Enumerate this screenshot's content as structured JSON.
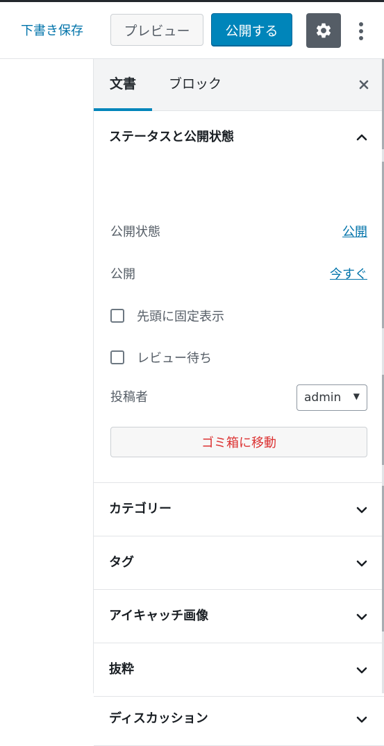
{
  "header": {
    "save_draft": "下書き保存",
    "preview": "プレビュー",
    "publish": "公開する",
    "settings_icon": "gear-icon",
    "more_icon": "more-vertical-icon"
  },
  "sidebar": {
    "tabs": [
      {
        "label": "文書",
        "active": true
      },
      {
        "label": "ブロック",
        "active": false
      }
    ],
    "close_icon": "close-icon",
    "status_panel": {
      "title": "ステータスと公開状態",
      "expanded": true,
      "visibility_label": "公開状態",
      "visibility_value": "公開",
      "publish_label": "公開",
      "publish_value": "今すぐ",
      "sticky_label": "先頭に固定表示",
      "sticky_checked": false,
      "pending_label": "レビュー待ち",
      "pending_checked": false,
      "author_label": "投稿者",
      "author_value": "admin",
      "trash_button": "ゴミ箱に移動"
    },
    "panels": [
      {
        "title": "カテゴリー",
        "expanded": false
      },
      {
        "title": "タグ",
        "expanded": false
      },
      {
        "title": "アイキャッチ画像",
        "expanded": false
      },
      {
        "title": "抜粋",
        "expanded": false
      },
      {
        "title": "ディスカッション",
        "expanded": false
      }
    ]
  },
  "colors": {
    "accent": "#0085ba",
    "link": "#0073aa",
    "danger": "#dc3232",
    "settings_bg": "#555d66"
  }
}
